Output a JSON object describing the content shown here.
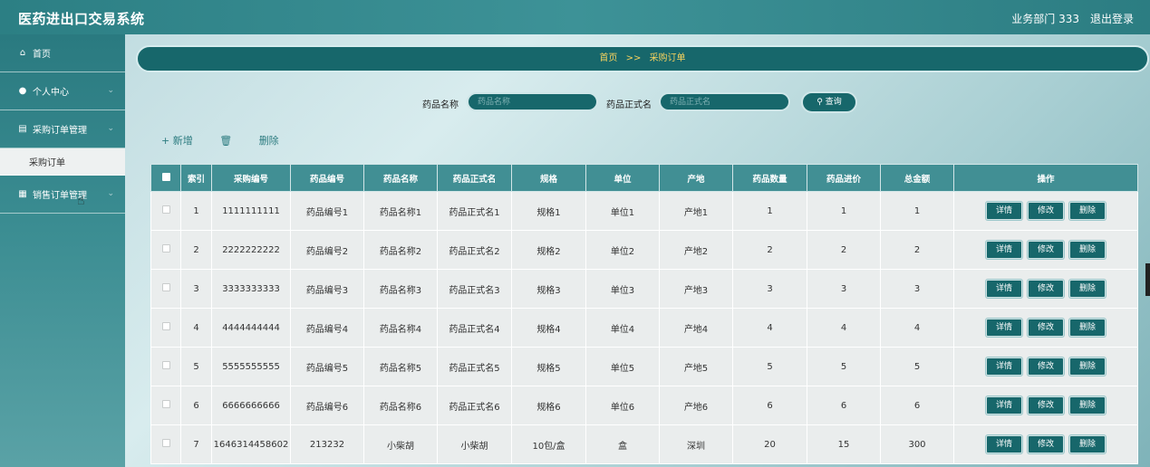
{
  "header": {
    "app_title": "医药进出口交易系统",
    "user": "业务部门 333",
    "logout": "退出登录"
  },
  "sidebar": {
    "items": [
      {
        "label": "首页",
        "icon": "home-icon"
      },
      {
        "label": "个人中心",
        "icon": "user-icon"
      },
      {
        "label": "采购订单管理",
        "icon": "cart-icon"
      },
      {
        "label": "销售订单管理",
        "icon": "grid-icon"
      }
    ],
    "sub_item": "采购订单"
  },
  "breadcrumb": {
    "home": "首页",
    "sep": ">>",
    "current": "采购订单"
  },
  "search": {
    "name_label": "药品名称",
    "name_placeholder": "药品名称",
    "formal_label": "药品正式名",
    "formal_placeholder": "药品正式名",
    "button": "查询"
  },
  "actions": {
    "add": "+ 新增",
    "delete": "删除"
  },
  "table": {
    "headers": [
      "索引",
      "采购编号",
      "药品编号",
      "药品名称",
      "药品正式名",
      "规格",
      "单位",
      "产地",
      "药品数量",
      "药品进价",
      "总金额",
      "操作"
    ],
    "op_labels": [
      "详情",
      "修改",
      "删除"
    ],
    "rows": [
      [
        "1",
        "1111111111",
        "药品编号1",
        "药品名称1",
        "药品正式名1",
        "规格1",
        "单位1",
        "产地1",
        "1",
        "1",
        "1"
      ],
      [
        "2",
        "2222222222",
        "药品编号2",
        "药品名称2",
        "药品正式名2",
        "规格2",
        "单位2",
        "产地2",
        "2",
        "2",
        "2"
      ],
      [
        "3",
        "3333333333",
        "药品编号3",
        "药品名称3",
        "药品正式名3",
        "规格3",
        "单位3",
        "产地3",
        "3",
        "3",
        "3"
      ],
      [
        "4",
        "4444444444",
        "药品编号4",
        "药品名称4",
        "药品正式名4",
        "规格4",
        "单位4",
        "产地4",
        "4",
        "4",
        "4"
      ],
      [
        "5",
        "5555555555",
        "药品编号5",
        "药品名称5",
        "药品正式名5",
        "规格5",
        "单位5",
        "产地5",
        "5",
        "5",
        "5"
      ],
      [
        "6",
        "6666666666",
        "药品编号6",
        "药品名称6",
        "药品正式名6",
        "规格6",
        "单位6",
        "产地6",
        "6",
        "6",
        "6"
      ],
      [
        "7",
        "1646314458602",
        "213232",
        "小柴胡",
        "小柴胡",
        "10包/盒",
        "盒",
        "深圳",
        "20",
        "15",
        "300"
      ]
    ]
  }
}
